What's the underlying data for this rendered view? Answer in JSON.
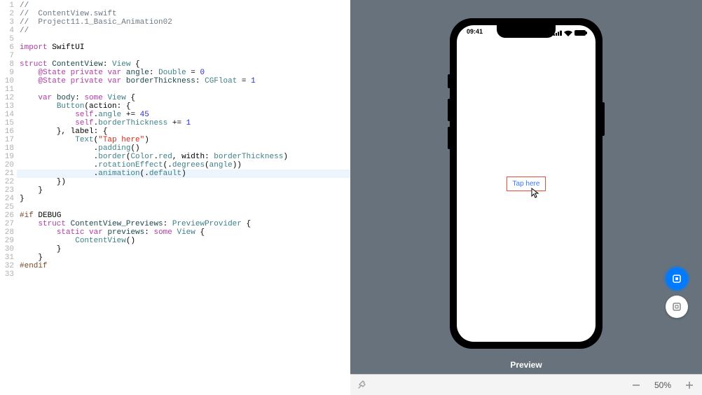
{
  "lines": [
    {
      "n": 1,
      "seg": [
        {
          "c": "c-comment",
          "t": "//"
        }
      ]
    },
    {
      "n": 2,
      "seg": [
        {
          "c": "c-comment",
          "t": "//  ContentView.swift"
        }
      ]
    },
    {
      "n": 3,
      "seg": [
        {
          "c": "c-comment",
          "t": "//  Project11.1_Basic_Animation02"
        }
      ]
    },
    {
      "n": 4,
      "seg": [
        {
          "c": "c-comment",
          "t": "//"
        }
      ]
    },
    {
      "n": 5,
      "seg": []
    },
    {
      "n": 6,
      "seg": [
        {
          "c": "c-kw",
          "t": "import"
        },
        {
          "t": " "
        },
        {
          "c": "",
          "t": "SwiftUI"
        }
      ]
    },
    {
      "n": 7,
      "seg": []
    },
    {
      "n": 8,
      "seg": [
        {
          "c": "c-kw",
          "t": "struct"
        },
        {
          "t": " "
        },
        {
          "c": "c-id",
          "t": "ContentView"
        },
        {
          "t": ": "
        },
        {
          "c": "c-type",
          "t": "View"
        },
        {
          "t": " {"
        }
      ]
    },
    {
      "n": 9,
      "seg": [
        {
          "t": "    "
        },
        {
          "c": "c-kw",
          "t": "@State"
        },
        {
          "t": " "
        },
        {
          "c": "c-kw",
          "t": "private"
        },
        {
          "t": " "
        },
        {
          "c": "c-kw",
          "t": "var"
        },
        {
          "t": " "
        },
        {
          "c": "c-id",
          "t": "angle"
        },
        {
          "t": ": "
        },
        {
          "c": "c-type",
          "t": "Double"
        },
        {
          "t": " = "
        },
        {
          "c": "c-num",
          "t": "0"
        }
      ]
    },
    {
      "n": 10,
      "seg": [
        {
          "t": "    "
        },
        {
          "c": "c-kw",
          "t": "@State"
        },
        {
          "t": " "
        },
        {
          "c": "c-kw",
          "t": "private"
        },
        {
          "t": " "
        },
        {
          "c": "c-kw",
          "t": "var"
        },
        {
          "t": " "
        },
        {
          "c": "c-id",
          "t": "borderThickness"
        },
        {
          "t": ": "
        },
        {
          "c": "c-type",
          "t": "CGFloat"
        },
        {
          "t": " = "
        },
        {
          "c": "c-num",
          "t": "1"
        }
      ]
    },
    {
      "n": 11,
      "seg": []
    },
    {
      "n": 12,
      "seg": [
        {
          "t": "    "
        },
        {
          "c": "c-kw",
          "t": "var"
        },
        {
          "t": " "
        },
        {
          "c": "c-id",
          "t": "body"
        },
        {
          "t": ": "
        },
        {
          "c": "c-kw",
          "t": "some"
        },
        {
          "t": " "
        },
        {
          "c": "c-type",
          "t": "View"
        },
        {
          "t": " {"
        }
      ]
    },
    {
      "n": 13,
      "seg": [
        {
          "t": "        "
        },
        {
          "c": "c-type",
          "t": "Button"
        },
        {
          "t": "(action: {"
        }
      ]
    },
    {
      "n": 14,
      "seg": [
        {
          "t": "            "
        },
        {
          "c": "c-kw",
          "t": "self"
        },
        {
          "t": "."
        },
        {
          "c": "c-prop",
          "t": "angle"
        },
        {
          "t": " += "
        },
        {
          "c": "c-num",
          "t": "45"
        }
      ]
    },
    {
      "n": 15,
      "seg": [
        {
          "t": "            "
        },
        {
          "c": "c-kw",
          "t": "self"
        },
        {
          "t": "."
        },
        {
          "c": "c-prop",
          "t": "borderThickness"
        },
        {
          "t": " += "
        },
        {
          "c": "c-num",
          "t": "1"
        }
      ]
    },
    {
      "n": 16,
      "seg": [
        {
          "t": "        }, label: {"
        }
      ]
    },
    {
      "n": 17,
      "seg": [
        {
          "t": "            "
        },
        {
          "c": "c-type",
          "t": "Text"
        },
        {
          "t": "("
        },
        {
          "c": "c-str",
          "t": "\"Tap here\""
        },
        {
          "t": ")"
        }
      ]
    },
    {
      "n": 18,
      "seg": [
        {
          "t": "                ."
        },
        {
          "c": "c-fn",
          "t": "padding"
        },
        {
          "t": "()"
        }
      ]
    },
    {
      "n": 19,
      "seg": [
        {
          "t": "                ."
        },
        {
          "c": "c-fn",
          "t": "border"
        },
        {
          "t": "("
        },
        {
          "c": "c-type",
          "t": "Color"
        },
        {
          "t": "."
        },
        {
          "c": "c-prop",
          "t": "red"
        },
        {
          "t": ", width: "
        },
        {
          "c": "c-prop",
          "t": "borderThickness"
        },
        {
          "t": ")"
        }
      ]
    },
    {
      "n": 20,
      "seg": [
        {
          "t": "                ."
        },
        {
          "c": "c-fn",
          "t": "rotationEffect"
        },
        {
          "t": "(."
        },
        {
          "c": "c-fn",
          "t": "degrees"
        },
        {
          "t": "("
        },
        {
          "c": "c-prop",
          "t": "angle"
        },
        {
          "t": "))"
        }
      ]
    },
    {
      "n": 21,
      "hl": true,
      "seg": [
        {
          "t": "                ."
        },
        {
          "c": "c-fn",
          "t": "animation"
        },
        {
          "t": "(."
        },
        {
          "c": "c-prop",
          "t": "default"
        },
        {
          "t": ")"
        }
      ]
    },
    {
      "n": 22,
      "seg": [
        {
          "t": "        })"
        }
      ]
    },
    {
      "n": 23,
      "seg": [
        {
          "t": "    }"
        }
      ]
    },
    {
      "n": 24,
      "seg": [
        {
          "t": "}"
        }
      ]
    },
    {
      "n": 25,
      "seg": []
    },
    {
      "n": 26,
      "seg": [
        {
          "c": "c-pre",
          "t": "#if"
        },
        {
          "t": " DEBUG"
        }
      ]
    },
    {
      "n": 27,
      "seg": [
        {
          "t": "    "
        },
        {
          "c": "c-kw",
          "t": "struct"
        },
        {
          "t": " "
        },
        {
          "c": "c-id",
          "t": "ContentView_Previews"
        },
        {
          "t": ": "
        },
        {
          "c": "c-type",
          "t": "PreviewProvider"
        },
        {
          "t": " {"
        }
      ]
    },
    {
      "n": 28,
      "seg": [
        {
          "t": "        "
        },
        {
          "c": "c-kw",
          "t": "static"
        },
        {
          "t": " "
        },
        {
          "c": "c-kw",
          "t": "var"
        },
        {
          "t": " "
        },
        {
          "c": "c-id",
          "t": "previews"
        },
        {
          "t": ": "
        },
        {
          "c": "c-kw",
          "t": "some"
        },
        {
          "t": " "
        },
        {
          "c": "c-type",
          "t": "View"
        },
        {
          "t": " {"
        }
      ]
    },
    {
      "n": 29,
      "seg": [
        {
          "t": "            "
        },
        {
          "c": "c-type",
          "t": "ContentView"
        },
        {
          "t": "()"
        }
      ]
    },
    {
      "n": 30,
      "seg": [
        {
          "t": "        }"
        }
      ]
    },
    {
      "n": 31,
      "seg": [
        {
          "t": "    }"
        }
      ]
    },
    {
      "n": 32,
      "seg": [
        {
          "c": "c-pre",
          "t": "#endif"
        }
      ]
    },
    {
      "n": 33,
      "seg": []
    }
  ],
  "preview": {
    "label": "Preview",
    "status_time": "09:41",
    "button_text": "Tap here",
    "zoom": "50%"
  }
}
